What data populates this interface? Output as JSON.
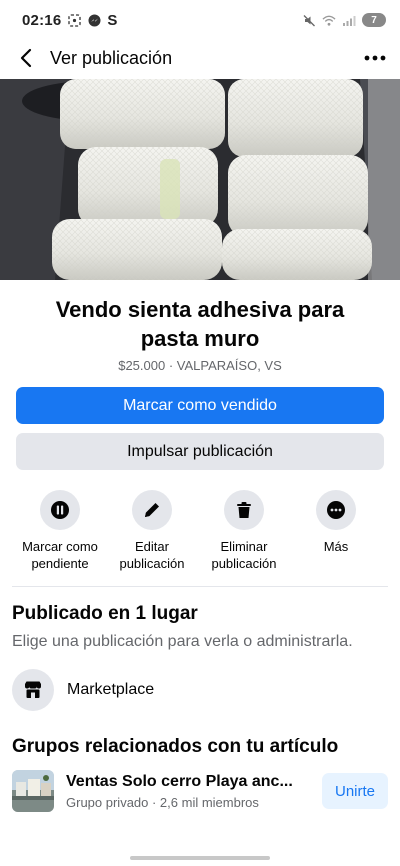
{
  "status_bar": {
    "time": "02:16",
    "letter": "S",
    "battery": "7"
  },
  "nav": {
    "title": "Ver publicación"
  },
  "listing": {
    "title": "Vendo sienta adhesiva para pasta muro",
    "subtitle": "$25.000 · VALPARAÍSO, VS"
  },
  "buttons": {
    "primary": "Marcar como vendido",
    "secondary": "Impulsar publicación"
  },
  "actions": [
    {
      "label": "Marcar como pendiente",
      "icon": "pause-icon"
    },
    {
      "label": "Editar publicación",
      "icon": "pencil-icon"
    },
    {
      "label": "Eliminar publicación",
      "icon": "trash-icon"
    },
    {
      "label": "Más",
      "icon": "more-icon"
    }
  ],
  "published": {
    "title": "Publicado en 1 lugar",
    "description": "Elige una publicación para verla o administrarla.",
    "place": "Marketplace"
  },
  "groups": {
    "title": "Grupos relacionados con tu artículo",
    "items": [
      {
        "name": "Ventas Solo cerro Playa anc...",
        "meta": "Grupo privado · 2,6 mil miembros",
        "join_label": "Unirte"
      }
    ]
  },
  "colors": {
    "accent": "#1877f2",
    "secondary_bg": "#e4e6eb",
    "muted_text": "#65676b"
  }
}
